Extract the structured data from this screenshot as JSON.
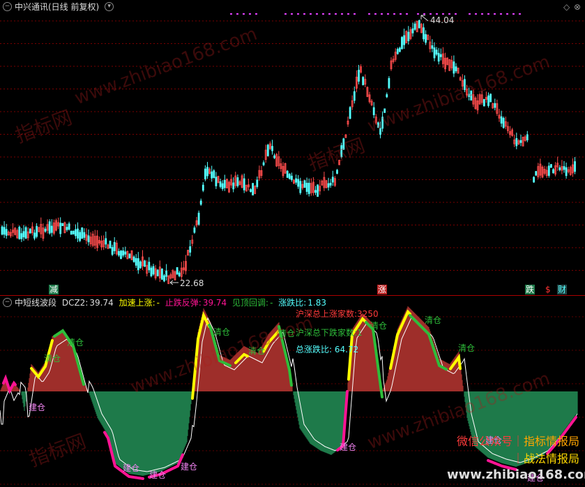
{
  "top": {
    "title": "中兴通讯(日线 前复权)",
    "high_label": "44.04",
    "low_label": "22.68",
    "markers": {
      "jian": "减",
      "zhang": "涨",
      "die": "跌",
      "dollar": "$",
      "cai": "财"
    },
    "corner_icons": [
      "◇",
      "⊗"
    ]
  },
  "bottom": {
    "indicator_name": "中短线波段",
    "dcz2_label": "DCZ2:",
    "dcz2_value": "39.74",
    "accel_label": "加速上涨:",
    "accel_value": "-",
    "stop_label": "止跌反弹:",
    "stop_value": "39.74",
    "top_label": "见顶回调:",
    "top_value": "-",
    "ratio_label": "涨跌比:",
    "ratio_value": "1.83",
    "info_up": "沪深总上涨家数:3250",
    "info_down": "沪深总下跌家数:1",
    "info_ratio": "总涨跌比: 64.72",
    "sell_tag": "清仓",
    "buy_tag": "建仓",
    "promo_wechat": "微信公众号",
    "promo_1": "指标情报局",
    "promo_2": "战法情报局",
    "watermark_site": "www.zhibiao168.com",
    "watermark_cn": "指标网"
  },
  "colors": {
    "up": "#ff4d4d",
    "down": "#54ffff",
    "pos_area": "#9e2f2a",
    "neg_area": "#1e7a4a",
    "yellow": "#ffff00",
    "green": "#2ebd3a",
    "magenta": "#ff1493"
  }
}
